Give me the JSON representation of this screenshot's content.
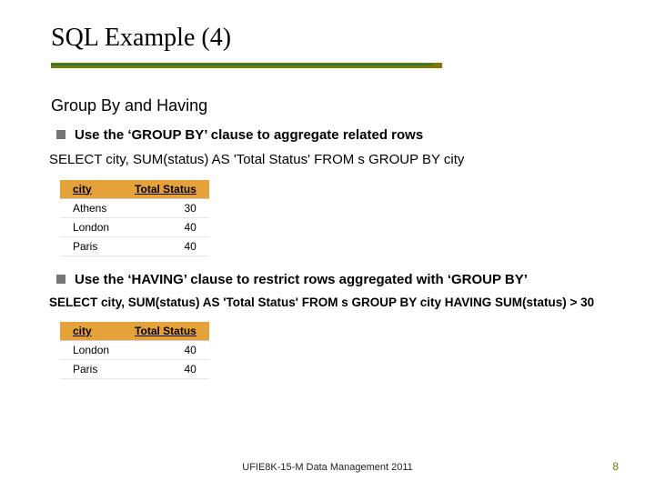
{
  "title": "SQL Example (4)",
  "subtitle": "Group By and Having",
  "bullets": {
    "b1": "Use the ‘GROUP BY’ clause to aggregate related rows",
    "b2": "Use the ‘HAVING’ clause to restrict rows aggregated with ‘GROUP BY’"
  },
  "sql1": "SELECT city, SUM(status) AS 'Total Status' FROM s GROUP BY city",
  "sql2": "SELECT city, SUM(status) AS 'Total Status' FROM s GROUP BY city HAVING SUM(status) > 30",
  "table1": {
    "headers": {
      "c1": "city",
      "c2": "Total Status"
    },
    "rows": [
      {
        "city": "Athens",
        "val": "30"
      },
      {
        "city": "London",
        "val": "40"
      },
      {
        "city": "Paris",
        "val": "40"
      }
    ]
  },
  "table2": {
    "headers": {
      "c1": "city",
      "c2": "Total Status"
    },
    "rows": [
      {
        "city": "London",
        "val": "40"
      },
      {
        "city": "Paris",
        "val": "40"
      }
    ]
  },
  "footer": "UFIE8K-15-M Data Management 2011",
  "page": "8",
  "chart_data": [
    {
      "type": "table",
      "title": "GROUP BY result",
      "columns": [
        "city",
        "Total Status"
      ],
      "rows": [
        [
          "Athens",
          30
        ],
        [
          "London",
          40
        ],
        [
          "Paris",
          40
        ]
      ]
    },
    {
      "type": "table",
      "title": "HAVING result",
      "columns": [
        "city",
        "Total Status"
      ],
      "rows": [
        [
          "London",
          40
        ],
        [
          "Paris",
          40
        ]
      ]
    }
  ]
}
